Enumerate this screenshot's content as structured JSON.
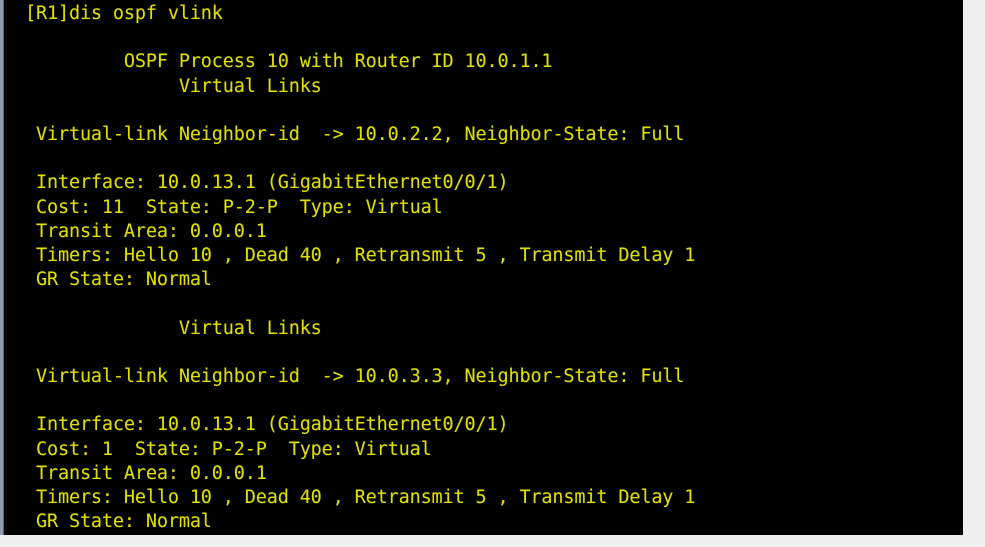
{
  "terminal": {
    "title": "OSPF virtual link console output",
    "colors": {
      "background": "#000000",
      "foreground": "#dede00",
      "chrome": "#efefef",
      "left_strip": "#9fb0c2"
    },
    "prompt": "[R1]",
    "command": "dis ospf vlink",
    "lines": [
      "[R1]dis ospf vlink",
      "",
      "         OSPF Process 10 with Router ID 10.0.1.1",
      "              Virtual Links",
      "",
      " Virtual-link Neighbor-id  -> 10.0.2.2, Neighbor-State: Full",
      "",
      " Interface: 10.0.13.1 (GigabitEthernet0/0/1)",
      " Cost: 11  State: P-2-P  Type: Virtual",
      " Transit Area: 0.0.0.1",
      " Timers: Hello 10 , Dead 40 , Retransmit 5 , Transmit Delay 1",
      " GR State: Normal",
      "",
      "              Virtual Links",
      "",
      " Virtual-link Neighbor-id  -> 10.0.3.3, Neighbor-State: Full",
      "",
      " Interface: 10.0.13.1 (GigabitEthernet0/0/1)",
      " Cost: 1  State: P-2-P  Type: Virtual",
      " Transit Area: 0.0.0.1",
      " Timers: Hello 10 , Dead 40 , Retransmit 5 , Transmit Delay 1",
      " GR State: Normal"
    ],
    "parsed": {
      "process_id": "10",
      "router_id": "10.0.1.1",
      "section_header": "Virtual Links",
      "virtual_links": [
        {
          "neighbor_id": "10.0.2.2",
          "neighbor_state": "Full",
          "interface_ip": "10.0.13.1",
          "interface_name": "GigabitEthernet0/0/1",
          "cost": "11",
          "state": "P-2-P",
          "type": "Virtual",
          "transit_area": "0.0.0.1",
          "hello": "10",
          "dead": "40",
          "retransmit": "5",
          "transmit_delay": "1",
          "gr_state": "Normal"
        },
        {
          "neighbor_id": "10.0.3.3",
          "neighbor_state": "Full",
          "interface_ip": "10.0.13.1",
          "interface_name": "GigabitEthernet0/0/1",
          "cost": "1",
          "state": "P-2-P",
          "type": "Virtual",
          "transit_area": "0.0.0.1",
          "hello": "10",
          "dead": "40",
          "retransmit": "5",
          "transmit_delay": "1",
          "gr_state": "Normal"
        }
      ]
    }
  }
}
